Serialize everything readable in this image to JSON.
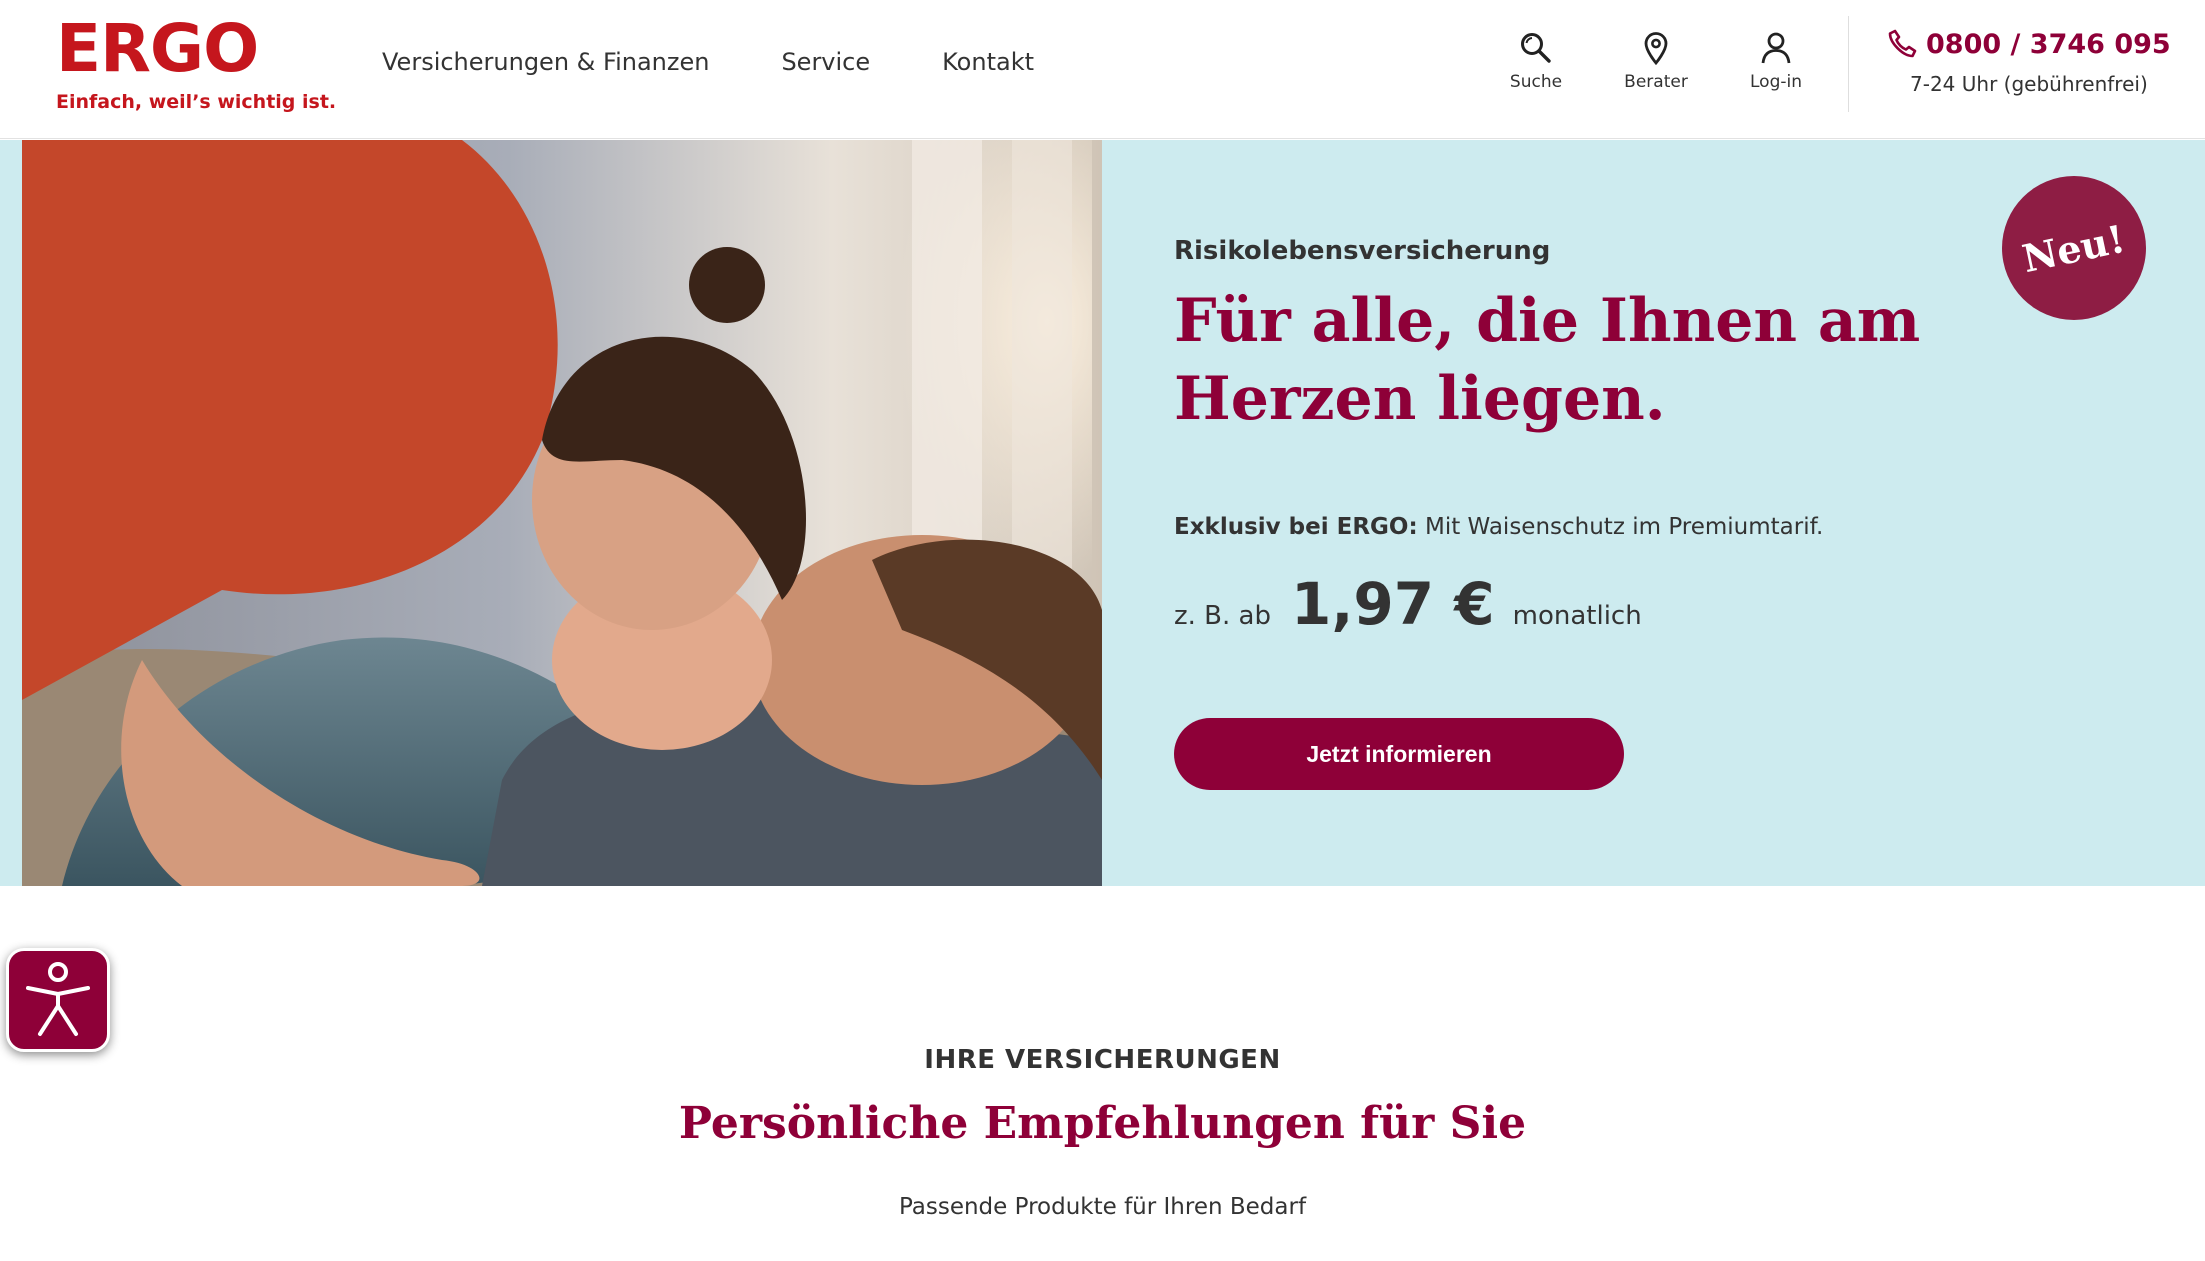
{
  "brand": {
    "name": "ERGO",
    "claim": "Einfach, weil’s wichtig ist.",
    "color": "#c5161d"
  },
  "nav": {
    "items": [
      {
        "label": "Versicherungen & Finanzen"
      },
      {
        "label": "Service"
      },
      {
        "label": "Kontakt"
      }
    ]
  },
  "utilities": {
    "search": {
      "label": "Suche",
      "icon": "search-icon"
    },
    "advisor": {
      "label": "Berater",
      "icon": "location-pin-icon"
    },
    "login": {
      "label": "Log-in",
      "icon": "user-icon"
    }
  },
  "contact": {
    "phone": "0800 / 3746 095",
    "hours": "7-24 Uhr (gebührenfrei)",
    "icon": "phone-icon"
  },
  "hero": {
    "kicker": "Risikolebensversicherung",
    "title": "Für alle, die Ihnen am Herzen liegen.",
    "text_bold": "Exklusiv bei ERGO:",
    "text_rest": " Mit Waisenschutz im Premiumtarif.",
    "price_prefix": "z. B. ab",
    "price_value": "1,97 €",
    "price_suffix": "monatlich",
    "cta": "Jetzt informieren",
    "badge": "Neu!",
    "image_alt": "Familie mit Baby im Bett",
    "background": "#cdebef",
    "accent": "#8e0038"
  },
  "accessibility": {
    "icon": "accessibility-icon"
  },
  "section": {
    "kicker": "IHRE VERSICHERUNGEN",
    "title": "Persönliche Empfehlungen für Sie",
    "subtitle": "Passende Produkte für Ihren Bedarf"
  }
}
